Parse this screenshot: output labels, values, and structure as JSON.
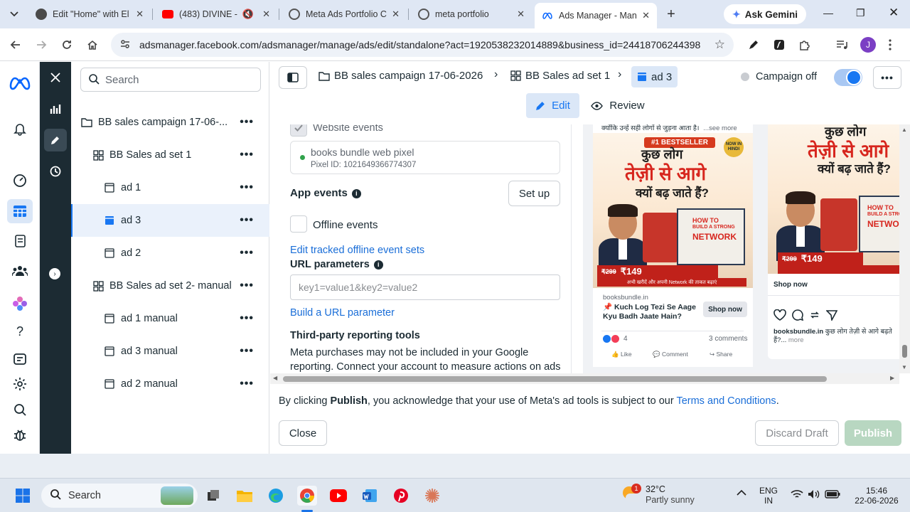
{
  "browser": {
    "tabs": [
      {
        "label": "Edit \"Home\" with El",
        "favicon": "wordpress-icon",
        "color": "#4a4a4a"
      },
      {
        "label": "(483) DIVINE - M",
        "favicon": "youtube-icon",
        "color": "#ff0000"
      },
      {
        "label": "Meta Ads Portfolio C",
        "favicon": "chatgpt-icon",
        "color": "#555555"
      },
      {
        "label": "meta portfolio",
        "favicon": "google-icon",
        "color": "#555555"
      },
      {
        "label": "Ads Manager - Man",
        "favicon": "meta-icon",
        "color": "#0866ff"
      }
    ],
    "gemini_label": "Ask Gemini",
    "url": "adsmanager.facebook.com/adsmanager/manage/ads/edit/standalone?act=1920538232014889&business_id=24418706244398...",
    "profile_initial": "J"
  },
  "tree": {
    "search_placeholder": "Search",
    "items": [
      {
        "label": "BB sales campaign 17-06-...",
        "level": "campaign"
      },
      {
        "label": "BB Sales ad set 1",
        "level": "adset"
      },
      {
        "label": "ad 1",
        "level": "ad"
      },
      {
        "label": "ad 3",
        "level": "ad",
        "selected": true
      },
      {
        "label": "ad 2",
        "level": "ad"
      },
      {
        "label": "BB Sales ad set 2- manual",
        "level": "adset"
      },
      {
        "label": "ad 1 manual",
        "level": "ad"
      },
      {
        "label": "ad 3 manual",
        "level": "ad"
      },
      {
        "label": "ad 2 manual",
        "level": "ad"
      }
    ],
    "more_label": "•••"
  },
  "header": {
    "breadcrumb_campaign": "BB sales campaign 17-06-2026",
    "breadcrumb_adset": "BB Sales ad set 1",
    "breadcrumb_ad": "ad 3",
    "campaign_status": "Campaign off",
    "more_label": "•••",
    "edit_label": "Edit",
    "review_label": "Review"
  },
  "form": {
    "website_events_label": "Website events",
    "pixel_name": "books bundle web pixel",
    "pixel_id": "Pixel ID: 1021649366774307",
    "app_events_label": "App events",
    "setup_label": "Set up",
    "offline_events_label": "Offline events",
    "edit_offline_link": "Edit tracked offline event sets",
    "url_params_label": "URL parameters",
    "url_params_placeholder": "key1=value1&key2=value2",
    "build_url_link": "Build a URL parameter",
    "third_party_heading": "Third-party reporting tools",
    "third_party_text_1": "Meta purchases may not be included in your Google",
    "third_party_text_2": "reporting. Connect your account to measure actions on ads"
  },
  "preview": {
    "card1": {
      "caption": "क्योंकि उन्हें सही लोगों से जुड़ना आता है।",
      "see_more": "...see more",
      "badge": "#1 BESTSELLER",
      "now_in_hindi": "NOW IN HINDI",
      "headline_1": "कुछ लोग",
      "headline_2": "तेज़ी से आगे",
      "headline_3": "क्यों बढ़ जाते हैं?",
      "book_title_1": "HOW TO",
      "book_title_2": "BUILD A STRONG",
      "book_title_3": "NETWORK",
      "old_price": "₹299",
      "price": "₹149",
      "cta_strip": "अभी खरीदें और अपनी Network की ताकत बढ़ाएं",
      "domain": "booksbundle.in",
      "title": "Kuch Log Tezi Se Aage Kyu Badh Jaate Hain?",
      "shop_now": "Shop now",
      "reactions": "4",
      "comments": "3 comments",
      "like": "Like",
      "comment": "Comment",
      "share": "Share"
    },
    "card2": {
      "headline_1": "कुछ लोग",
      "headline_2": "तेज़ी से आगे",
      "headline_3": "क्यों बढ़ जाते हैं?",
      "book_title_1": "HOW TO",
      "book_title_2": "BUILD A STRONG",
      "book_title_3": "NETWO",
      "old_price": "₹299",
      "price": "₹149",
      "shop_now": "Shop now",
      "caption_user": "booksbundle.in",
      "caption_text": "कुछ लोग तेज़ी से आगे बढ़ते हैं?...",
      "more": "more"
    }
  },
  "footer": {
    "publish_notice_prefix": "By clicking ",
    "publish_notice_bold": "Publish",
    "publish_notice_mid": ", you acknowledge that your use of Meta's ad tools is subject to our ",
    "terms_link": "Terms and Conditions",
    "publish_notice_end": ".",
    "close_label": "Close",
    "discard_label": "Discard Draft",
    "publish_label": "Publish"
  },
  "taskbar": {
    "search_label": "Search",
    "weather_badge": "1",
    "temperature": "32°C",
    "weather_desc": "Partly sunny",
    "lang_1": "ENG",
    "lang_2": "IN",
    "time": "15:46",
    "date": "22-06-2026"
  },
  "colors": {
    "meta_blue": "#1877f2",
    "dark_strip": "#1c2b33",
    "publish_disabled": "#b8d7c1",
    "link": "#1a6ed8"
  }
}
